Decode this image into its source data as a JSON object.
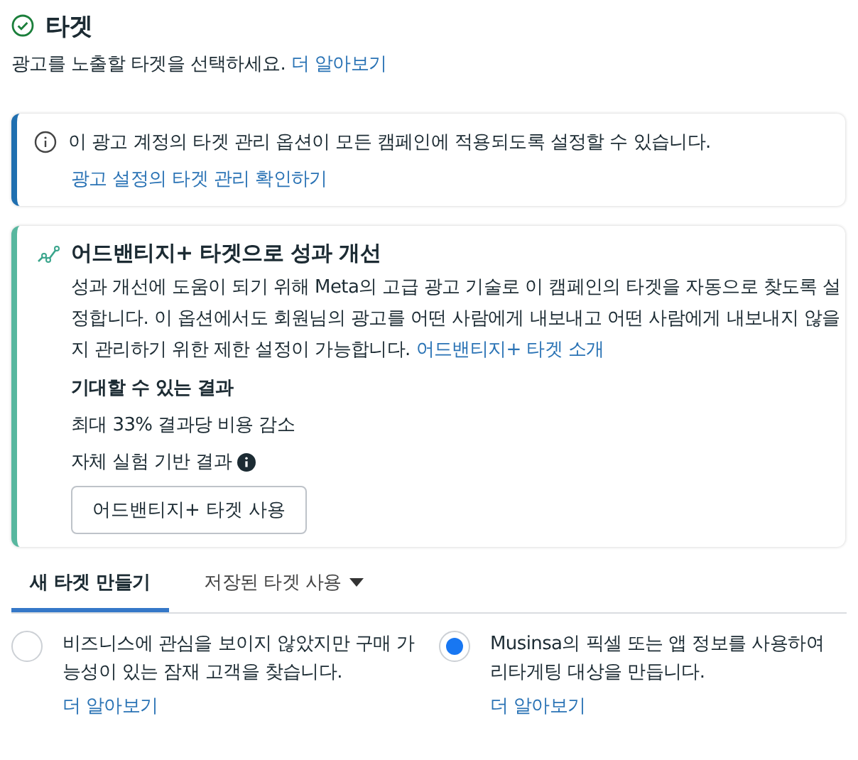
{
  "header": {
    "title": "타겟",
    "subtitle": "광고를 노출할 타겟을 선택하세요.",
    "learn_more": "더 알아보기"
  },
  "info_card": {
    "text": "이 광고 계정의 타겟 관리 옵션이 모든 캠페인에 적용되도록 설정할 수 있습니다.",
    "link": "광고 설정의 타겟 관리 확인하기"
  },
  "advantage_card": {
    "title": "어드밴티지+ 타겟으로 성과 개선",
    "body": "성과 개선에 도움이 되기 위해 Meta의 고급 광고 기술로 이 캠페인의 타겟을 자동으로 찾도록 설정합니다. 이 옵션에서도 회원님의 광고를 어떤 사람에게 내보내고 어떤 사람에게 내보내지 않을지 관리하기 위한 제한 설정이 가능합니다.",
    "body_link": "어드밴티지+ 타겟 소개",
    "expected_heading": "기대할 수 있는 결과",
    "expected_result": "최대 33% 결과당 비용 감소",
    "basis": "자체 실험 기반 결과",
    "button": "어드밴티지+ 타겟 사용"
  },
  "tabs": [
    {
      "label": "새 타겟 만들기",
      "selected": true,
      "dropdown": false
    },
    {
      "label": "저장된 타겟 사용",
      "selected": false,
      "dropdown": true
    }
  ],
  "options": [
    {
      "text": "비즈니스에 관심을 보이지 않았지만 구매 가능성이 있는 잠재 고객을 찾습니다.",
      "link": "더 알아보기",
      "selected": false
    },
    {
      "text": "Musinsa의 픽셀 또는 앱 정보를 사용하여 리타게팅 대상을 만듭니다.",
      "link": "더 알아보기",
      "selected": true
    }
  ]
}
